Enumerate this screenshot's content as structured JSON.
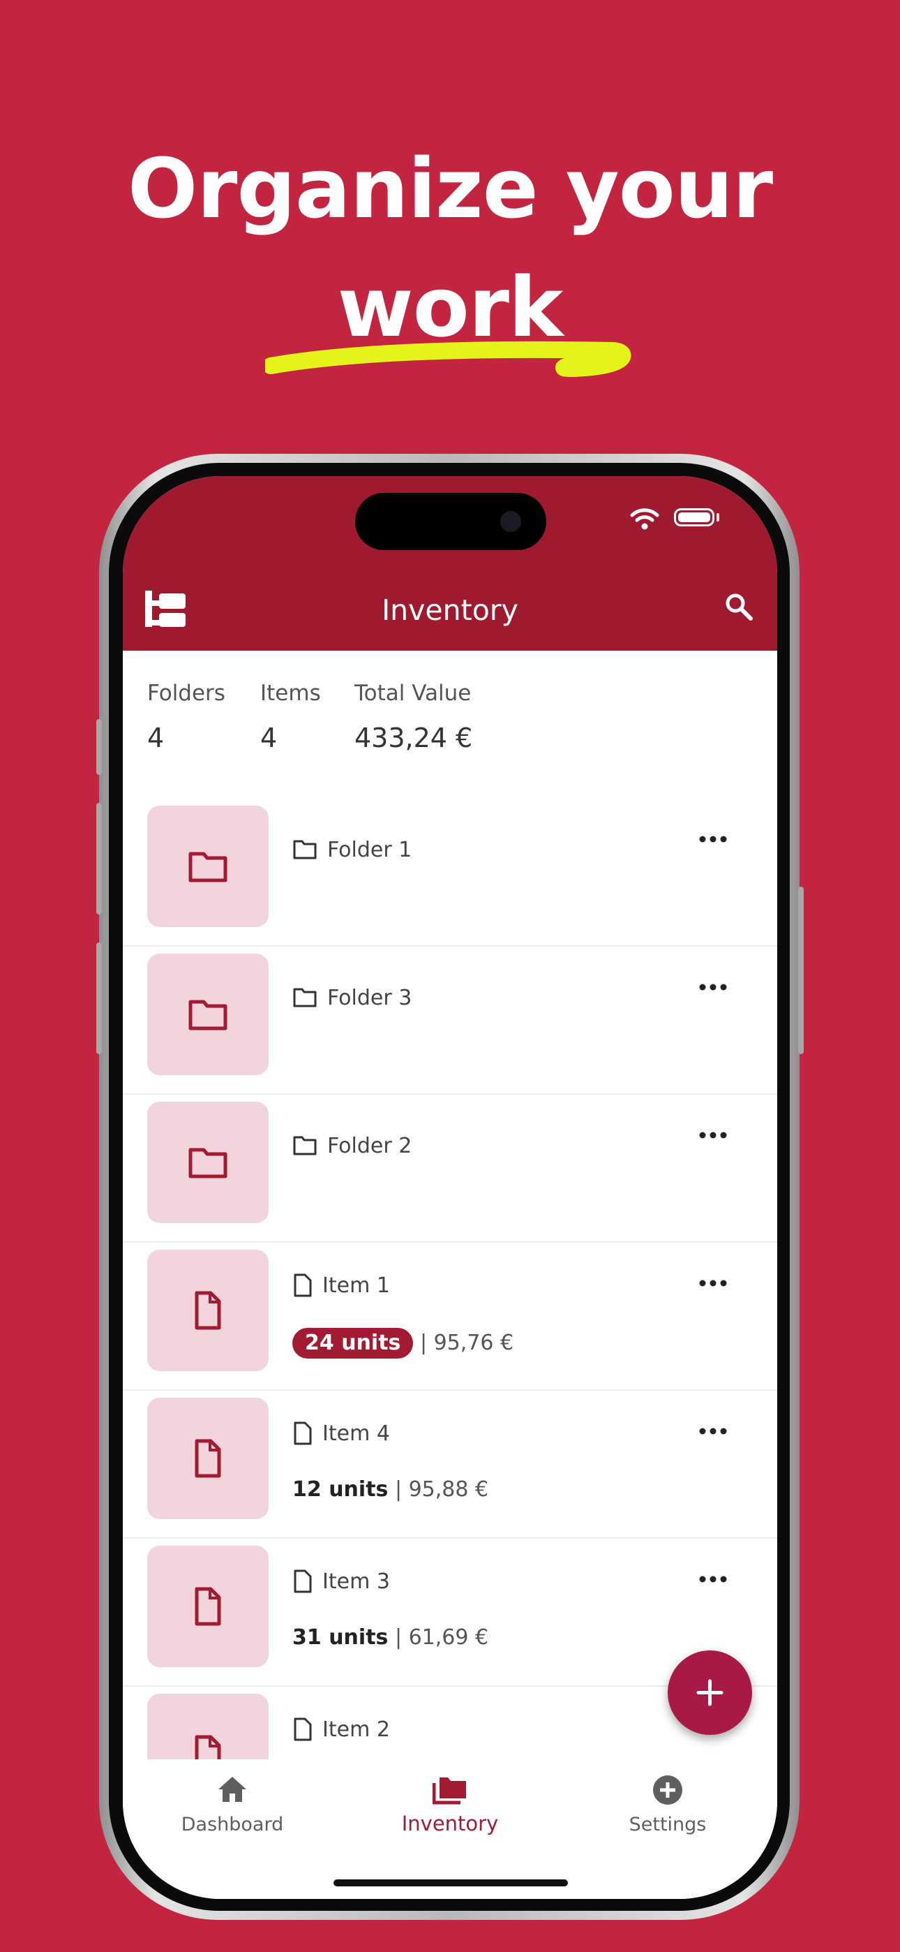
{
  "hero": {
    "line1": "Organize your",
    "line2": "work"
  },
  "colors": {
    "background": "#c32540",
    "appbar": "#9f1a2f",
    "accent": "#a31b33",
    "thumb": "#f1d4dc",
    "highlight": "#e4f41a"
  },
  "appbar": {
    "title": "Inventory",
    "left_icon": "folder-tree-icon",
    "right_icon": "search-icon"
  },
  "stats": [
    {
      "label": "Folders",
      "value": "4"
    },
    {
      "label": "Items",
      "value": "4"
    },
    {
      "label": "Total Value",
      "value": "433,24 €"
    }
  ],
  "list": [
    {
      "kind": "folder",
      "name": "Folder 1"
    },
    {
      "kind": "folder",
      "name": "Folder 3"
    },
    {
      "kind": "folder",
      "name": "Folder 2"
    },
    {
      "kind": "item",
      "name": "Item 1",
      "units": "24 units",
      "price": "| 95,76 €",
      "pill": true
    },
    {
      "kind": "item",
      "name": "Item 4",
      "units": "12 units",
      "price": "| 95,88 €"
    },
    {
      "kind": "item",
      "name": "Item 3",
      "units": "31 units",
      "price": "| 61,69 €"
    },
    {
      "kind": "item",
      "name": "Item 2"
    }
  ],
  "fab": {
    "icon": "plus-icon"
  },
  "nav": [
    {
      "label": "Dashboard",
      "icon": "home-icon"
    },
    {
      "label": "Inventory",
      "icon": "folders-icon",
      "active": true
    },
    {
      "label": "Settings",
      "icon": "plus-circle-icon"
    }
  ]
}
